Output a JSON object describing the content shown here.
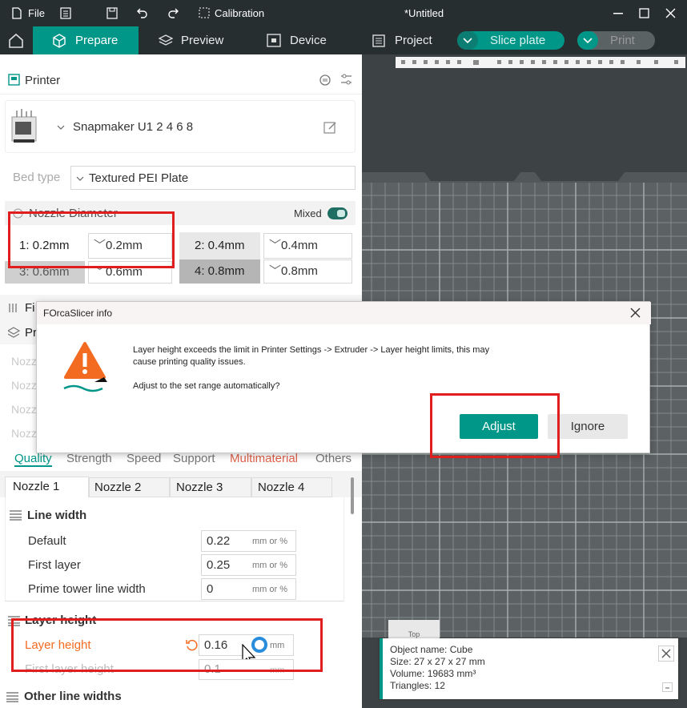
{
  "titlebar": {
    "file": "File",
    "calibration": "Calibration",
    "doc_title": "*Untitled"
  },
  "tabs": {
    "prepare": "Prepare",
    "preview": "Preview",
    "device": "Device",
    "project": "Project",
    "slice": "Slice plate",
    "print": "Print"
  },
  "printer": {
    "section_title": "Printer",
    "model": "Snapmaker U1 2 4 6 8",
    "bed_label": "Bed type",
    "bed_value": "Textured PEI Plate",
    "nozzle_label": "Nozzle Diameter",
    "mixed_label": "Mixed",
    "nozzles": [
      {
        "label": "1: 0.2mm",
        "value": "0.2mm"
      },
      {
        "label": "2: 0.4mm",
        "value": "0.4mm"
      },
      {
        "label": "3: 0.6mm",
        "value": "0.6mm"
      },
      {
        "label": "4: 0.8mm",
        "value": "0.8mm"
      }
    ]
  },
  "left_hidden": {
    "fi": "Fi",
    "pr": "Pr",
    "nozz": "Nozz"
  },
  "param_tabs": [
    "Quality",
    "Strength",
    "Speed",
    "Support",
    "Multimaterial",
    "Others"
  ],
  "nozzle_tabs": [
    "Nozzle 1",
    "Nozzle 2",
    "Nozzle 3",
    "Nozzle 4"
  ],
  "line_width": {
    "title": "Line width",
    "unit": "mm or %",
    "rows": [
      {
        "label": "Default",
        "value": "0.22"
      },
      {
        "label": "First layer",
        "value": "0.25"
      },
      {
        "label": "Prime tower line width",
        "value": "0"
      }
    ]
  },
  "layer_height": {
    "title": "Layer height",
    "label": "Layer height",
    "value": "0.16",
    "unit": "mm",
    "first_label": "First layer height",
    "first_value": "0.1"
  },
  "other_line_widths": "Other line widths",
  "dialog": {
    "title": "FOrcaSlicer info",
    "message1": "Layer height exceeds the limit in Printer Settings -> Extruder -> Layer height limits, this may",
    "message2": "cause printing quality issues.",
    "question": "Adjust to the set range automatically?",
    "adjust": "Adjust",
    "ignore": "Ignore"
  },
  "viewport": {
    "top_label": "Top"
  },
  "object_info": {
    "name": "Object name: Cube",
    "size": "Size: 27 x 27 x 27 mm",
    "volume": "Volume: 19683 mm³",
    "triangles": "Triangles: 12"
  },
  "colors": {
    "accent": "#009688",
    "highlight": "#e01e1e",
    "warning": "#f36b21",
    "dark": "#262e30"
  }
}
